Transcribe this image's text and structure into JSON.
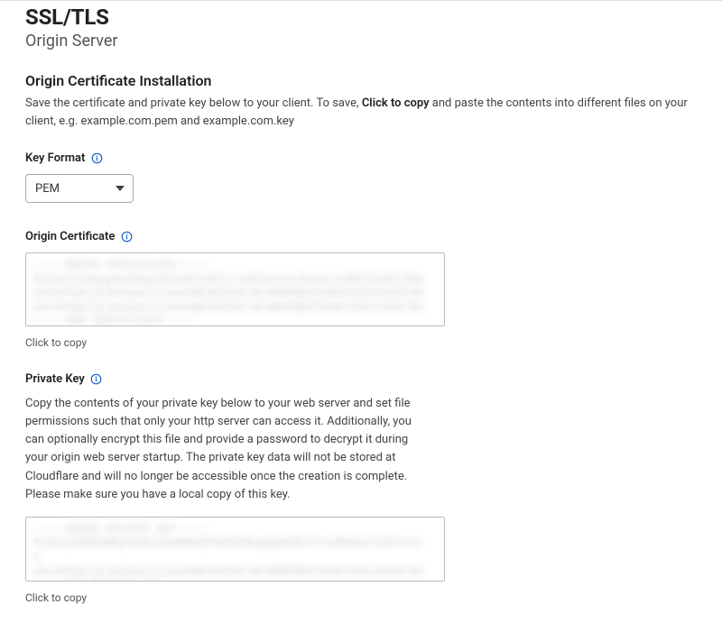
{
  "page": {
    "title": "SSL/TLS",
    "subtitle": "Origin Server"
  },
  "section": {
    "heading": "Origin Certificate Installation",
    "description_pre": "Save the certificate and private key below to your client. To save, ",
    "description_bold": "Click to copy",
    "description_post": " and paste the contents into different files on your client, e.g. example.com.pem and example.com.key"
  },
  "key_format": {
    "label": "Key Format",
    "selected": "PEM"
  },
  "origin_cert": {
    "label": "Origin Certificate",
    "content": "-----BEGIN CERTIFICATE-----\nMIIDxTCCAq2gAwIBAgIUExampleBlurredContentRedacted01234567890\nabcdefghijklmnopqrstuvwxABCDEFGHIJKLMNOPQRSTUVWXYZ0123456789\nabcdefghijklmnopqrstuvwxABCDEFGHIJKLMNOPQRSTUVWXYZ0123456789\n-----END CERTIFICATE-----",
    "copy_label": "Click to copy"
  },
  "private_key": {
    "label": "Private Key",
    "description": "Copy the contents of your private key below to your web server and set file permissions such that only your http server can access it. Additionally, you can optionally encrypt this file and provide a password to decrypt it during your origin web server startup. The private key data will not be stored at Cloudflare and will no longer be accessible once the creation is complete. Please make sure you have a local copy of this key.",
    "content": "-----BEGIN PRIVATE KEY-----\nMIIEvgIBADANBgkqhkiG9w0BAQEFAASCBKgwggSkBlurredRedactedxxxxxx\nabcdefghijklmnopqrstuvwxABCDEFGHIJKLMNOPQRSTUVWXYZ0123456789\n-----END PRIVATE KEY-----",
    "copy_label": "Click to copy"
  }
}
